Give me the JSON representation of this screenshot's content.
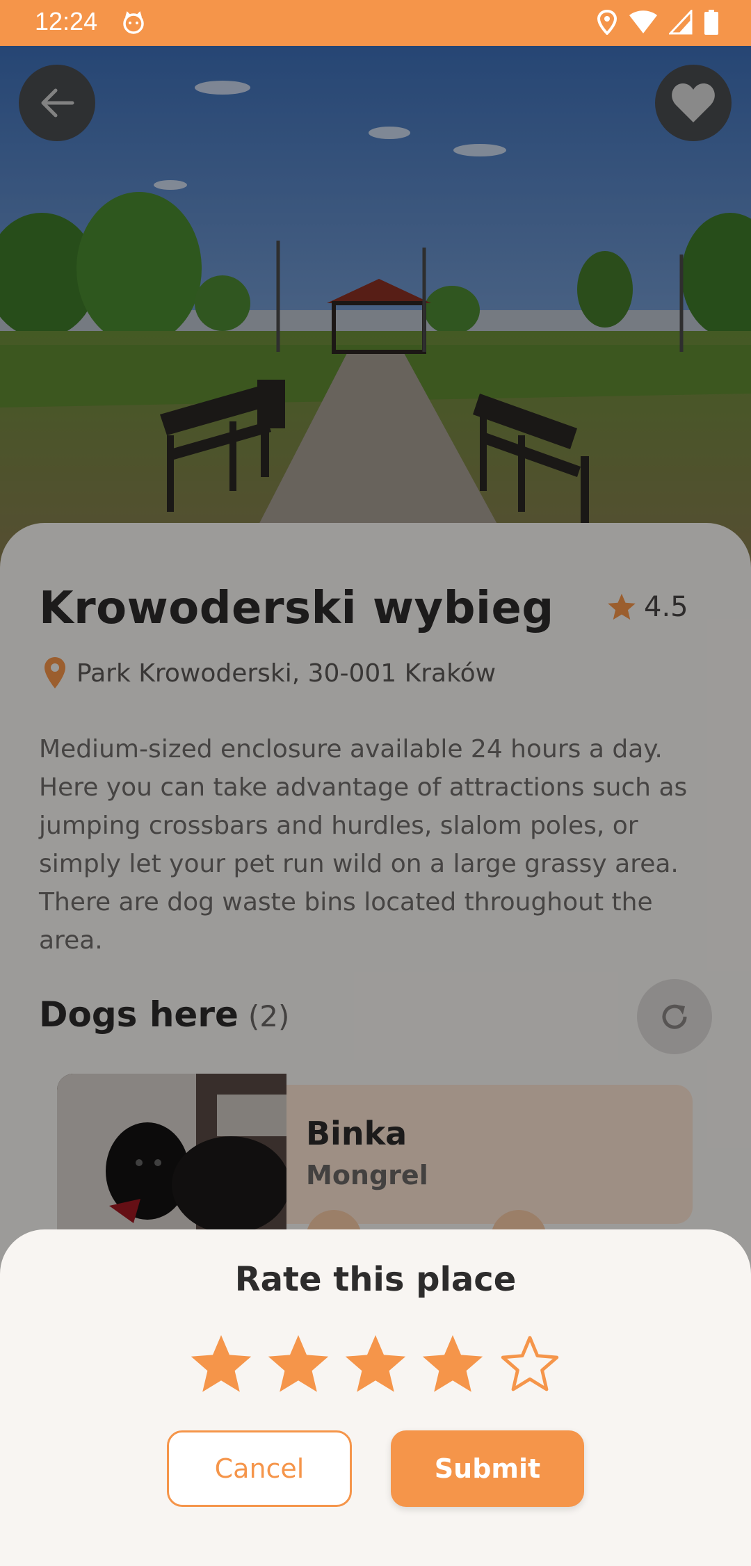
{
  "status_bar": {
    "time": "12:24"
  },
  "place": {
    "title": "Krowoderski wybieg",
    "rating": "4.5",
    "address": "Park Krowoderski, 30-001 Kraków",
    "description": "Medium-sized enclosure available 24 hours a day. Here you can take advantage of attractions such as jumping crossbars and hurdles, slalom poles, or simply let your pet run wild on a large grassy area. There are dog waste bins located throughout the area."
  },
  "dogs_section": {
    "title": "Dogs here",
    "count": "(2)",
    "dogs": [
      {
        "name": "Binka",
        "breed": "Mongrel"
      }
    ]
  },
  "rating_dialog": {
    "title": "Rate this place",
    "selected_stars": 4,
    "max_stars": 5,
    "cancel_label": "Cancel",
    "submit_label": "Submit"
  },
  "colors": {
    "accent": "#f5954a",
    "text_dark": "#2d2c2c",
    "sheet_bg": "#f8f5f2"
  },
  "icons": [
    "arrow-left-icon",
    "heart-icon",
    "star-icon",
    "location-pin-icon",
    "refresh-icon",
    "wifi-icon",
    "signal-icon",
    "battery-icon",
    "location-icon",
    "cat-face-icon"
  ]
}
